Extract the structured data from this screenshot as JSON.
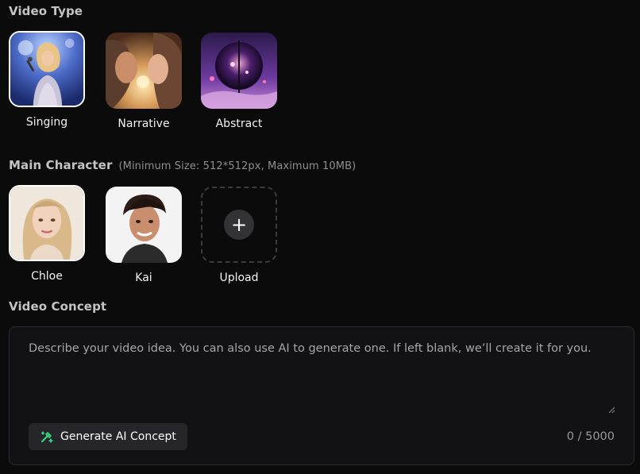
{
  "video_type": {
    "title": "Video Type",
    "options": [
      {
        "label": "Singing",
        "selected": true
      },
      {
        "label": "Narrative",
        "selected": false
      },
      {
        "label": "Abstract",
        "selected": false
      }
    ]
  },
  "main_character": {
    "title": "Main Character",
    "hint": "(Minimum Size: 512*512px, Maximum 10MB)",
    "options": [
      {
        "label": "Chloe",
        "selected": true
      },
      {
        "label": "Kai",
        "selected": false
      }
    ],
    "upload_label": "Upload",
    "upload_icon": "plus-icon"
  },
  "video_concept": {
    "title": "Video Concept",
    "placeholder": "Describe your video idea. You can also use AI to generate one. If left blank, we’ll create it for you.",
    "value": "",
    "generate_label": "Generate AI Concept",
    "generate_icon": "magic-pen-sparkle-icon",
    "counter": "0 / 5000"
  },
  "colors": {
    "background": "#0b0b0c",
    "accent_green": "#3ddc84",
    "selected_border": "#ffffff"
  }
}
